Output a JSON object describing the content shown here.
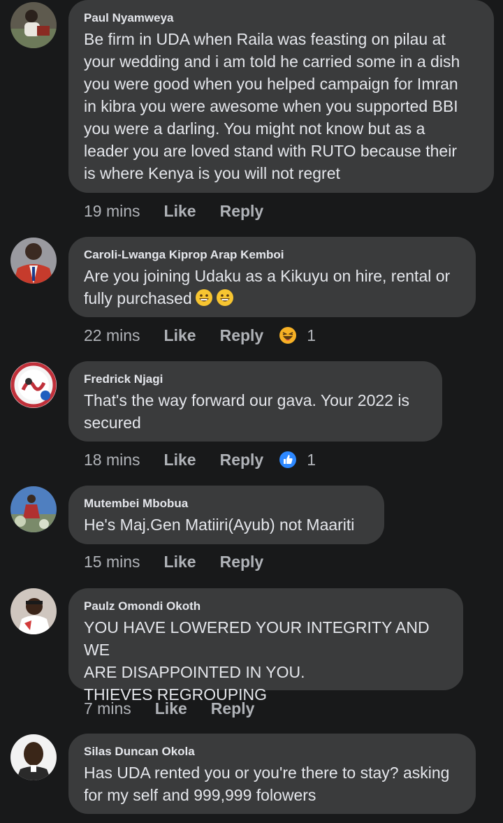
{
  "comments": [
    {
      "author": "Paul Nyamweya",
      "text": "Be firm in UDA when Raila was feasting on pilau at\nyour wedding and i am told he carried some in a dish\nyou were good when you helped campaign for Imran\nin kibra you were awesome when you supported BBI\nyou were a darling. You might not know but as a\nleader you are loved stand with RUTO because their\nis where Kenya is you will not regret",
      "time": "19 mins",
      "like": "Like",
      "reply": "Reply"
    },
    {
      "author": "Caroli-Lwanga Kiprop Arap Kemboi",
      "text": "Are you joining Udaku as a Kikuyu on hire, rental or\nfully purchased",
      "emoji": [
        "grinning-face-emoji",
        "grinning-face-emoji"
      ],
      "time": "22 mins",
      "like": "Like",
      "reply": "Reply",
      "reaction": {
        "icon": "haha-reaction-icon",
        "count": "1"
      }
    },
    {
      "author": "Fredrick Njagi",
      "text": "That's the way forward our gava.  Your 2022 is\nsecured",
      "time": "18 mins",
      "like": "Like",
      "reply": "Reply",
      "reaction": {
        "icon": "like-reaction-icon",
        "count": "1"
      }
    },
    {
      "author": "Mutembei Mbobua",
      "text": "He's Maj.Gen Matiiri(Ayub) not Maariti",
      "time": "15 mins",
      "like": "Like",
      "reply": "Reply"
    },
    {
      "author": "Paulz Omondi Okoth",
      "text": "YOU HAVE LOWERED YOUR INTEGRITY AND WE\nARE DISAPPOINTED IN YOU.\nTHIEVES REGROUPING",
      "time": "7 mins",
      "like": "Like",
      "reply": "Reply"
    },
    {
      "author": "Silas Duncan Okola",
      "text": "Has UDA rented you or you're there to stay? asking\nfor my self and 999,999 folowers"
    }
  ],
  "colors": {
    "background": "#18191a",
    "bubble": "#3a3b3c",
    "text": "#e4e6eb",
    "secondary": "#b0b3b8",
    "like_blue": "#2d88ff",
    "haha_yellow": "#f7b125"
  }
}
